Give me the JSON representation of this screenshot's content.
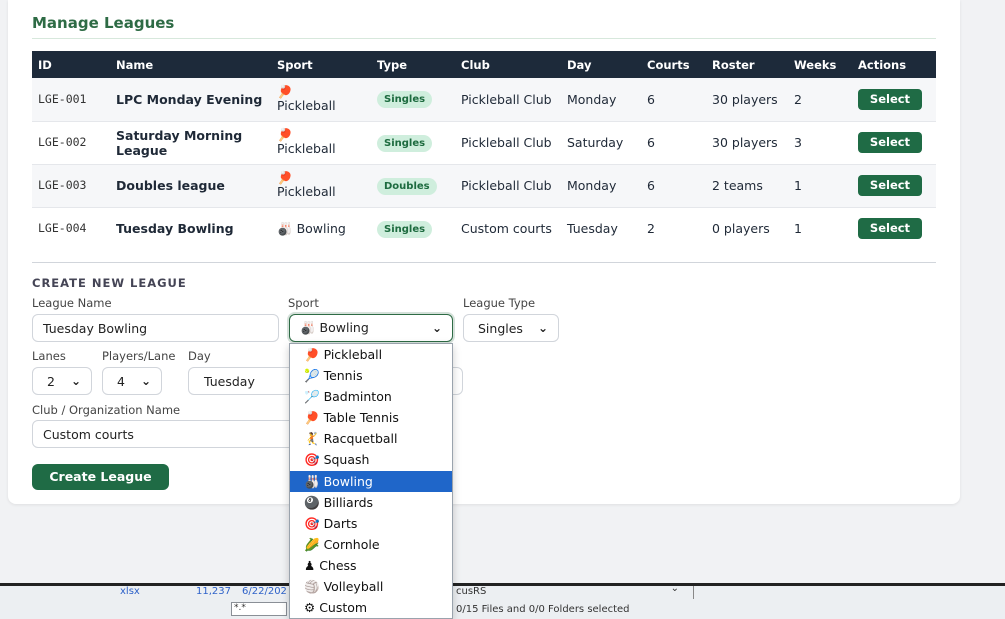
{
  "title": "Manage Leagues",
  "table": {
    "headers": [
      "ID",
      "Name",
      "Sport",
      "Type",
      "Club",
      "Day",
      "Courts",
      "Roster",
      "Weeks",
      "Actions"
    ],
    "rows": [
      {
        "id": "LGE-001",
        "name": "LPC Monday Evening",
        "sport_icon": "🏓",
        "sport": "Pickleball",
        "type": "Singles",
        "club": "Pickleball Club",
        "day": "Monday",
        "courts": "6",
        "roster": "30 players",
        "weeks": "2",
        "action": "Select"
      },
      {
        "id": "LGE-002",
        "name": "Saturday Morning League",
        "sport_icon": "🏓",
        "sport": "Pickleball",
        "type": "Singles",
        "club": "Pickleball Club",
        "day": "Saturday",
        "courts": "6",
        "roster": "30 players",
        "weeks": "3",
        "action": "Select"
      },
      {
        "id": "LGE-003",
        "name": "Doubles league",
        "sport_icon": "🏓",
        "sport": "Pickleball",
        "type": "Doubles",
        "club": "Pickleball Club",
        "day": "Monday",
        "courts": "6",
        "roster": "2 teams",
        "weeks": "1",
        "action": "Select"
      },
      {
        "id": "LGE-004",
        "name": "Tuesday Bowling",
        "sport_icon": "🎳",
        "sport": "Bowling",
        "type": "Singles",
        "club": "Custom courts",
        "day": "Tuesday",
        "courts": "2",
        "roster": "0 players",
        "weeks": "1",
        "action": "Select"
      }
    ]
  },
  "form": {
    "section_title": "CREATE NEW LEAGUE",
    "league_name_label": "League Name",
    "league_name_value": "Tuesday Bowling",
    "sport_label": "Sport",
    "sport_value": "🎳 Bowling",
    "league_type_label": "League Type",
    "league_type_value": "Singles",
    "lanes_label": "Lanes",
    "lanes_value": "2",
    "players_per_lane_label": "Players/Lane",
    "players_per_lane_value": "4",
    "day_label": "Day",
    "day_value": "Tuesday",
    "club_label": "Club / Organization Name",
    "club_value": "Custom courts",
    "create_button": "Create League"
  },
  "sport_options": [
    {
      "icon": "🏓",
      "label": "Pickleball",
      "selected": false
    },
    {
      "icon": "🎾",
      "label": "Tennis",
      "selected": false
    },
    {
      "icon": "🏸",
      "label": "Badminton",
      "selected": false
    },
    {
      "icon": "🏓",
      "label": "Table Tennis",
      "selected": false
    },
    {
      "icon": "🤾",
      "label": "Racquetball",
      "selected": false
    },
    {
      "icon": "🎯",
      "label": "Squash",
      "selected": false
    },
    {
      "icon": "🎳",
      "label": "Bowling",
      "selected": true
    },
    {
      "icon": "🎱",
      "label": "Billiards",
      "selected": false
    },
    {
      "icon": "🎯",
      "label": "Darts",
      "selected": false
    },
    {
      "icon": "🌽",
      "label": "Cornhole",
      "selected": false
    },
    {
      "icon": "♟",
      "label": "Chess",
      "selected": false
    },
    {
      "icon": "🏐",
      "label": "Volleyball",
      "selected": false
    },
    {
      "icon": "⚙",
      "label": "Custom",
      "selected": false
    }
  ],
  "taskbar": {
    "file_ext": "xlsx",
    "file_size": "11,237",
    "file_date": "6/22/202",
    "filter_value": "*.*",
    "combo_text": "cusRS",
    "status": "0/15 Files and 0/0 Folders selected"
  },
  "colors": {
    "accent": "#1f6b45",
    "header_bg": "#1d2a3a",
    "badge_bg": "#cfeedd",
    "selected_option": "#1f66c9"
  }
}
